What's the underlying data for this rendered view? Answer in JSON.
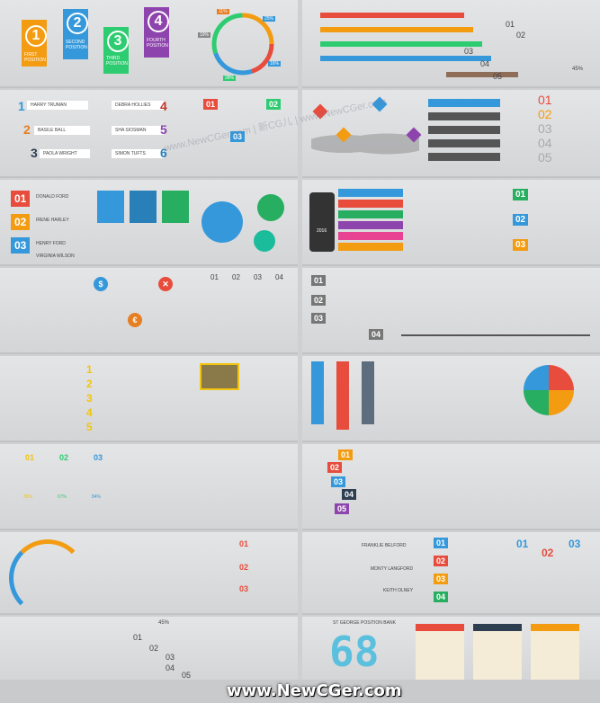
{
  "panel1": {
    "tiles": [
      {
        "number": "1",
        "label": "FIRST POSITION",
        "color": "#f39c12"
      },
      {
        "number": "2",
        "label": "SECOND POSITION",
        "color": "#3498db"
      },
      {
        "number": "3",
        "label": "THIRD POSITION",
        "color": "#2ecc71"
      },
      {
        "number": "4",
        "label": "FOURTH POSITION",
        "color": "#8e44ad"
      }
    ],
    "ring_labels": [
      "11%",
      "25%",
      "19%",
      "16%",
      "28%"
    ]
  },
  "panel2": {
    "steps": [
      "01",
      "02",
      "03",
      "04",
      "05"
    ],
    "percent": "45%"
  },
  "panel3": {
    "people": [
      "HARRY TRUMAN",
      "DEBRA HOLLIES",
      "BASILE BALL",
      "SHA SIOSMAN",
      "PAOLA WRIGHT",
      "SIMON TUFTS"
    ],
    "numbers": [
      "1",
      "2",
      "3",
      "4",
      "5",
      "6"
    ],
    "box_numbers": [
      "01",
      "02",
      "03"
    ]
  },
  "panel4": {
    "numbers": [
      "01",
      "02",
      "03",
      "04",
      "05"
    ]
  },
  "panel5": {
    "numbers": [
      "01",
      "02",
      "03"
    ],
    "names": [
      "DONALD FORD",
      "IRENE HARLEY",
      "HENRY FORD",
      "VIRGINIA WILSON"
    ]
  },
  "panel6": {
    "phone_text": "2016",
    "numbers": [
      "01",
      "02",
      "03"
    ]
  },
  "panel7": {
    "circle_labels": [
      "$",
      "✕",
      "€"
    ],
    "numbers": [
      "01",
      "02",
      "03",
      "04"
    ]
  },
  "panel8": {
    "numbers": [
      "01",
      "02",
      "03",
      "04"
    ]
  },
  "panel9": {
    "steps": [
      "1",
      "2",
      "3",
      "4",
      "5"
    ]
  },
  "panel10": {},
  "panel11": {
    "numbers": [
      "01",
      "02",
      "03"
    ],
    "percents": [
      "35%",
      "67%",
      "84%"
    ]
  },
  "panel12": {
    "numbers": [
      "01",
      "02",
      "03",
      "04",
      "05"
    ]
  },
  "panel13": {
    "numbers": [
      "01",
      "02",
      "03"
    ]
  },
  "panel14": {
    "names": [
      "FRANKLIE BELFORD",
      "MONTY LANGFORD",
      "KEITH OLNEY"
    ],
    "numbers": [
      "01",
      "02",
      "03",
      "04"
    ],
    "arrows": [
      "01",
      "02",
      "03"
    ]
  },
  "panel15": {
    "steps": [
      "01",
      "02",
      "03",
      "04",
      "05"
    ],
    "percent": "45%"
  },
  "panel16": {
    "big_number": "68",
    "caption": "ST GEORGE POSITION BANK"
  },
  "footer": {
    "text": "www.NewCGer.com"
  },
  "watermark": "www.NewCGer.com | 新CG儿 | www.NewCGer.com"
}
